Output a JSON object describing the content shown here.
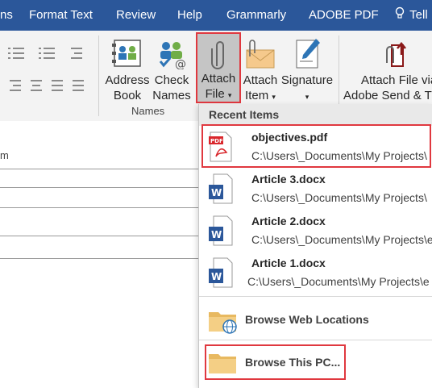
{
  "tabs": [
    "ns",
    "Format Text",
    "Review",
    "Help",
    "Grammarly",
    "ADOBE PDF",
    "Tell"
  ],
  "ribbon": {
    "address_book": [
      "Address",
      "Book"
    ],
    "check_names": [
      "Check",
      "Names"
    ],
    "attach_file": [
      "Attach",
      "File"
    ],
    "attach_item": [
      "Attach",
      "Item"
    ],
    "signature": "Signature",
    "attach_via": [
      "Attach File via",
      "Adobe Send & T"
    ],
    "names_group": "Names"
  },
  "mail": {
    "partial_label": "m"
  },
  "dropdown": {
    "header": "Recent Items",
    "items": [
      {
        "name": "objectives.pdf",
        "path": "C:\\Users\\_Documents\\My Projects\\",
        "type": "pdf"
      },
      {
        "name": "Article 3.docx",
        "path": "C:\\Users\\_Documents\\My Projects\\",
        "type": "docx"
      },
      {
        "name": "Article 2.docx",
        "path": "C:\\Users\\_Documents\\My Projects\\e",
        "type": "docx"
      },
      {
        "name": "Article 1.docx",
        "path": "C:\\Users\\_Documents\\My Projects\\e",
        "type": "docx"
      }
    ],
    "browse_web": "Browse Web Locations",
    "browse_pc": "Browse This PC..."
  },
  "colors": {
    "accent": "#2b579a",
    "highlight": "#e0383f",
    "word_blue": "#2b579a",
    "pdf_red": "#d9262b"
  }
}
